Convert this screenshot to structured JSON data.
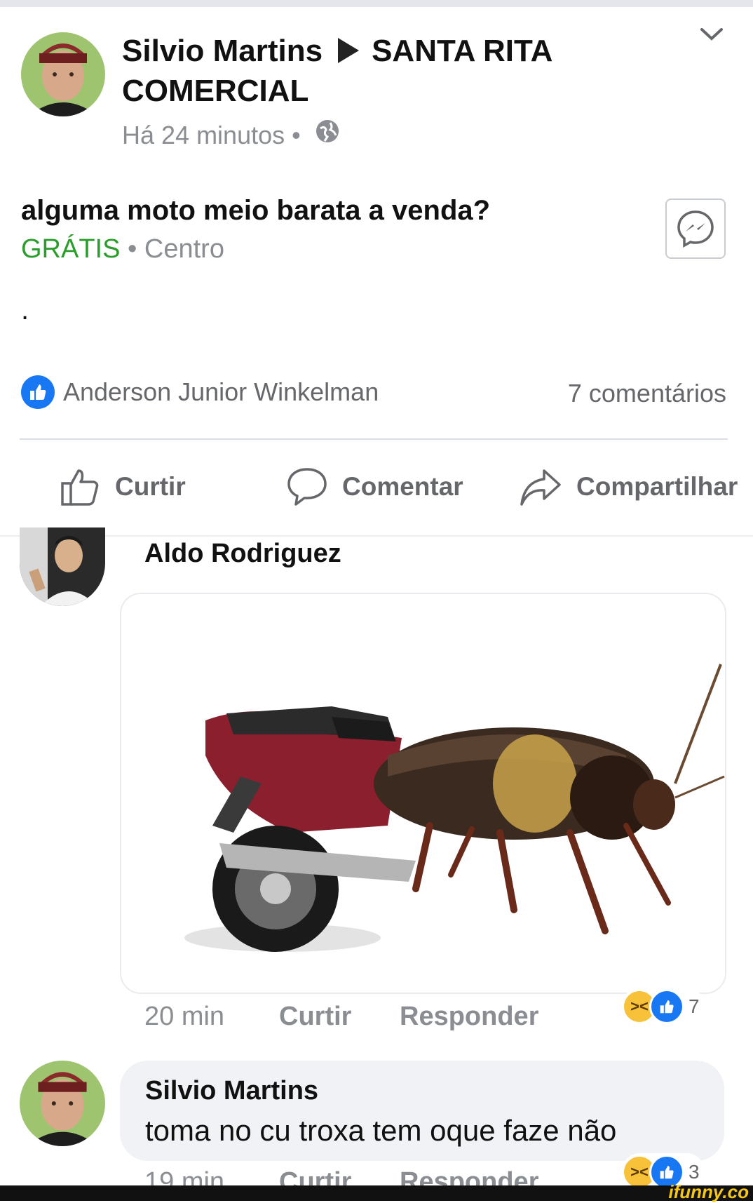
{
  "post": {
    "author": "Silvio Martins",
    "group": "SANTA RITA COMERCIAL",
    "time": "Há 24 minutos",
    "separator": "•",
    "title": "alguma moto meio barata a venda?",
    "price": "GRÁTIS",
    "location_sep": " • ",
    "location": "Centro",
    "body": ".",
    "liker": "Anderson Junior Winkelman",
    "comments_count": "7 comentários"
  },
  "actions": {
    "like": "Curtir",
    "comment": "Comentar",
    "share": "Compartilhar"
  },
  "comments": [
    {
      "author": "Aldo Rodriguez",
      "time": "20 min",
      "like": "Curtir",
      "reply": "Responder",
      "reactions": "7"
    },
    {
      "author": "Silvio Martins",
      "text": "toma no cu troxa tem oque faze não",
      "time": "19 min",
      "like": "Curtir",
      "reply": "Responder",
      "reactions": "3"
    }
  ],
  "watermark": "ifunny.co",
  "icons": [
    "chevron-down-icon",
    "globe-icon",
    "messenger-icon",
    "like-badge-icon",
    "thumbs-up-icon",
    "comment-icon",
    "share-icon",
    "haha-icon"
  ],
  "colors": {
    "accent": "#1877f2",
    "price": "#2a9d2a",
    "muted": "#8a8d91"
  }
}
